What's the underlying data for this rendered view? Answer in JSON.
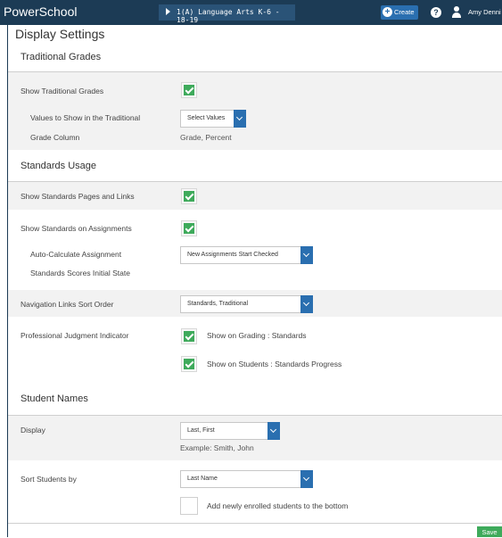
{
  "topbar": {
    "logo": "PowerSchool",
    "course": "1(A) Language Arts K-6 - 18-19",
    "create_label": "Create",
    "help_icon": "?",
    "user_name": "Amy Denni"
  },
  "page": {
    "title": "Display Settings"
  },
  "traditional": {
    "heading": "Traditional Grades",
    "show_label": "Show Traditional Grades",
    "show_checked": true,
    "values_label_line1": "Values to Show in the Traditional",
    "values_label_line2": "Grade Column",
    "values_select": "Select Values",
    "values_selected": "Grade, Percent"
  },
  "standards": {
    "heading": "Standards Usage",
    "pages_links_label": "Show Standards Pages and Links",
    "pages_links_checked": true,
    "on_assignments_label": "Show Standards on Assignments",
    "on_assignments_checked": true,
    "autocalc_label_line1": "Auto-Calculate Assignment",
    "autocalc_label_line2": "Standards Scores Initial State",
    "autocalc_select": "New Assignments Start Checked",
    "nav_order_label": "Navigation Links Sort Order",
    "nav_order_select": "Standards, Traditional",
    "pji_label": "Professional Judgment Indicator",
    "pji_grading": "Show on Grading : Standards",
    "pji_grading_checked": true,
    "pji_students": "Show on Students : Standards Progress",
    "pji_students_checked": true
  },
  "names": {
    "heading": "Student Names",
    "display_label": "Display",
    "display_select": "Last, First",
    "display_example": "Example: Smith, John",
    "sort_label": "Sort Students by",
    "sort_select": "Last Name",
    "new_students_label": "Add newly enrolled students to the bottom",
    "new_students_checked": false
  },
  "footer": {
    "save_label": "Save"
  },
  "colors": {
    "topbar": "#1c3b55",
    "accent_blue": "#2a6fb0",
    "check_green": "#3eaa5b"
  }
}
